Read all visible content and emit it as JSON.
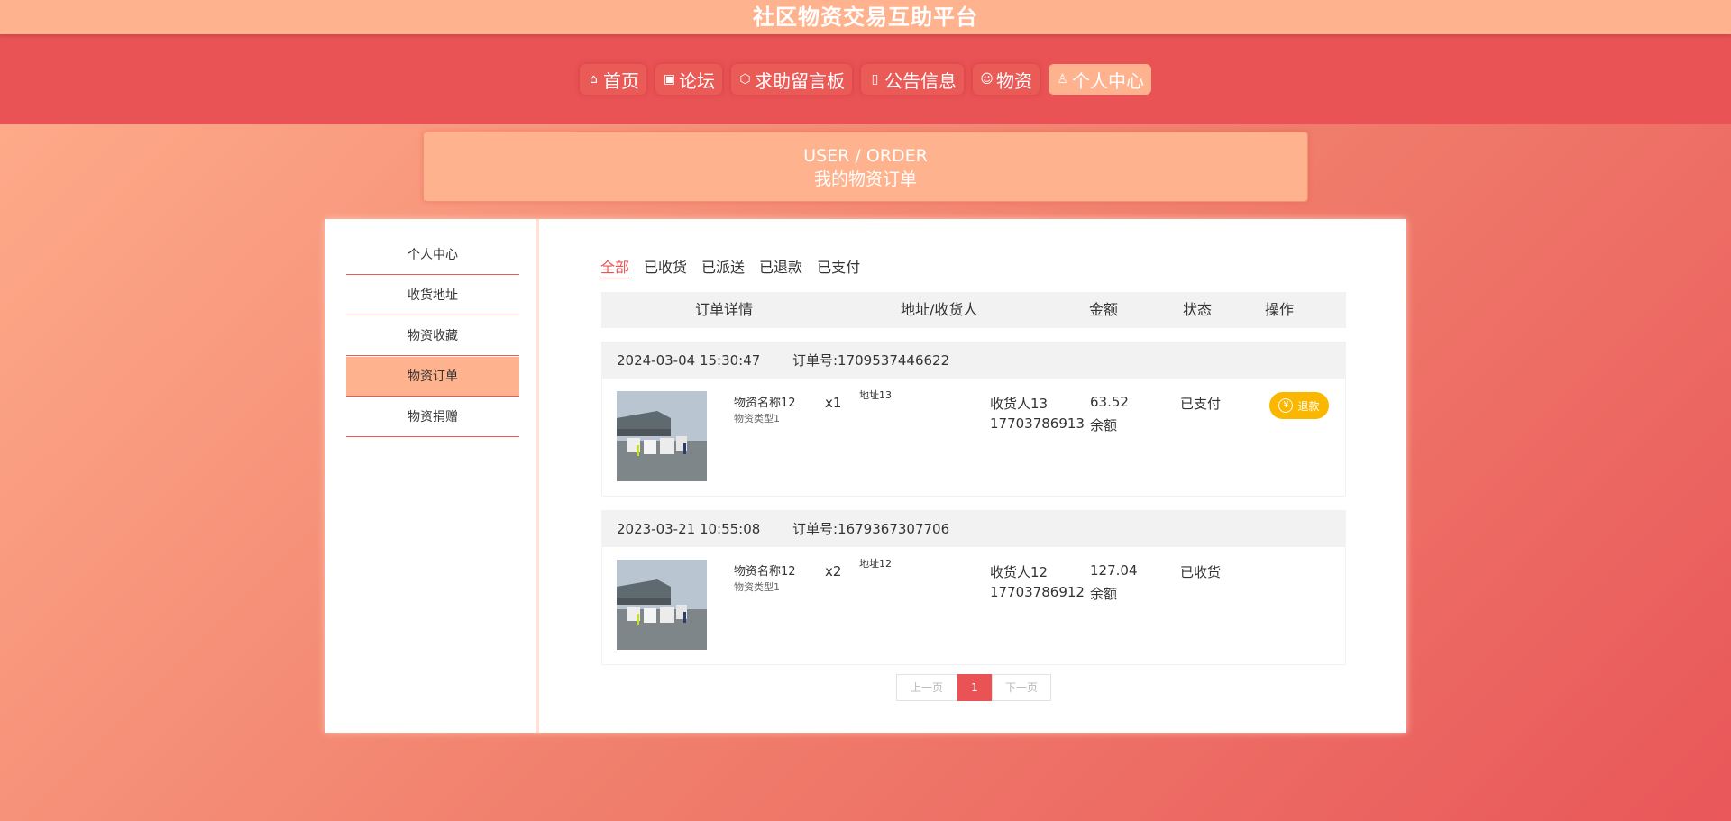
{
  "site_title": "社区物资交易互助平台",
  "nav": {
    "items": [
      {
        "label": "首页",
        "icon": "⌂"
      },
      {
        "label": "论坛",
        "icon": "▣"
      },
      {
        "label": "求助留言板",
        "icon": "⬡"
      },
      {
        "label": "公告信息",
        "icon": "▯"
      },
      {
        "label": "物资",
        "icon": "☺"
      },
      {
        "label": "个人中心",
        "icon": "♙"
      }
    ],
    "active_index": 5
  },
  "banner": {
    "en": "USER / ORDER",
    "zh": "我的物资订单"
  },
  "sidebar": {
    "items": [
      {
        "label": "个人中心"
      },
      {
        "label": "收货地址"
      },
      {
        "label": "物资收藏"
      },
      {
        "label": "物资订单"
      },
      {
        "label": "物资捐赠"
      }
    ],
    "active_index": 3
  },
  "tabs": {
    "items": [
      "全部",
      "已收货",
      "已派送",
      "已退款",
      "已支付"
    ],
    "active_index": 0
  },
  "table": {
    "headers": [
      "订单详情",
      "地址/收货人",
      "金额",
      "状态",
      "操作"
    ]
  },
  "orders": [
    {
      "time": "2024-03-04 15:30:47",
      "order_no": "订单号:1709537446622",
      "name": "物资名称12",
      "type": "物资类型1",
      "qty": "x1",
      "address": "地址13",
      "receiver": "收货人13",
      "phone": "17703786913",
      "amount": "63.52",
      "pay": "余额",
      "status": "已支付",
      "action": "退款"
    },
    {
      "time": "2023-03-21 10:55:08",
      "order_no": "订单号:1679367307706",
      "name": "物资名称12",
      "type": "物资类型1",
      "qty": "x2",
      "address": "地址12",
      "receiver": "收货人12",
      "phone": "17703786912",
      "amount": "127.04",
      "pay": "余额",
      "status": "已收货",
      "action": ""
    }
  ],
  "pagination": {
    "prev": "上一页",
    "current": "1",
    "next": "下一页"
  },
  "colors": {
    "primary": "#e95355",
    "accent": "#ffb28e",
    "refund": "#fbb600"
  }
}
